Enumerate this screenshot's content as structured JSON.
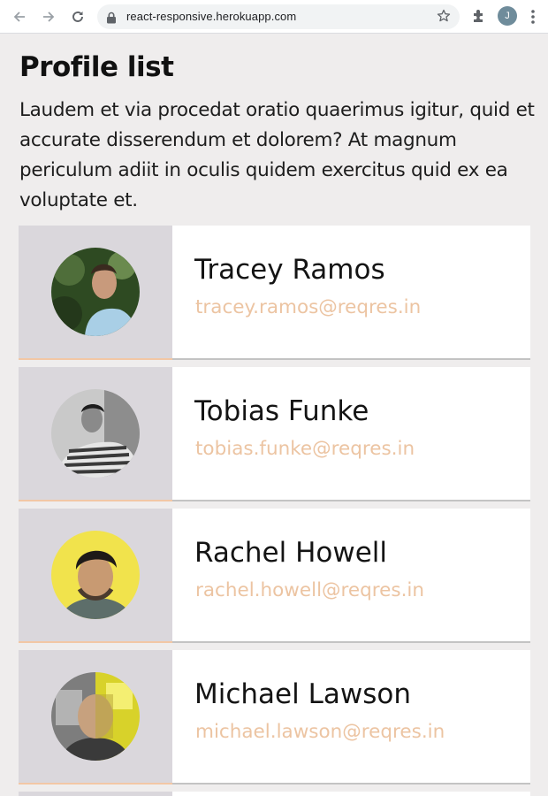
{
  "browser": {
    "url": "react-responsive.herokuapp.com",
    "profile_initial": "J",
    "icons": [
      "back-arrow-icon",
      "forward-arrow-icon",
      "reload-icon",
      "lock-icon",
      "star-icon",
      "puzzle-extension-icon",
      "kebab-menu-icon"
    ]
  },
  "page": {
    "title": "Profile list",
    "intro": "Laudem et via procedat oratio quaerimus igitur, quid et accurate disserendum et dolorem? At magnum periculum adiit in oculis quidem exercitus quid ex ea voluptate et."
  },
  "profiles": [
    {
      "name": "Tracey Ramos",
      "email": "tracey.ramos@reqres.in"
    },
    {
      "name": "Tobias Funke",
      "email": "tobias.funke@reqres.in"
    },
    {
      "name": "Rachel Howell",
      "email": "rachel.howell@reqres.in"
    },
    {
      "name": "Michael Lawson",
      "email": "michael.lawson@reqres.in"
    }
  ],
  "colors": {
    "page_bg": "#efeded",
    "card_bg": "#ffffff",
    "avatar_panel_bg": "#dad7dc",
    "email_text": "#ecc4a2",
    "accent_underline": "#f2c7a5"
  }
}
